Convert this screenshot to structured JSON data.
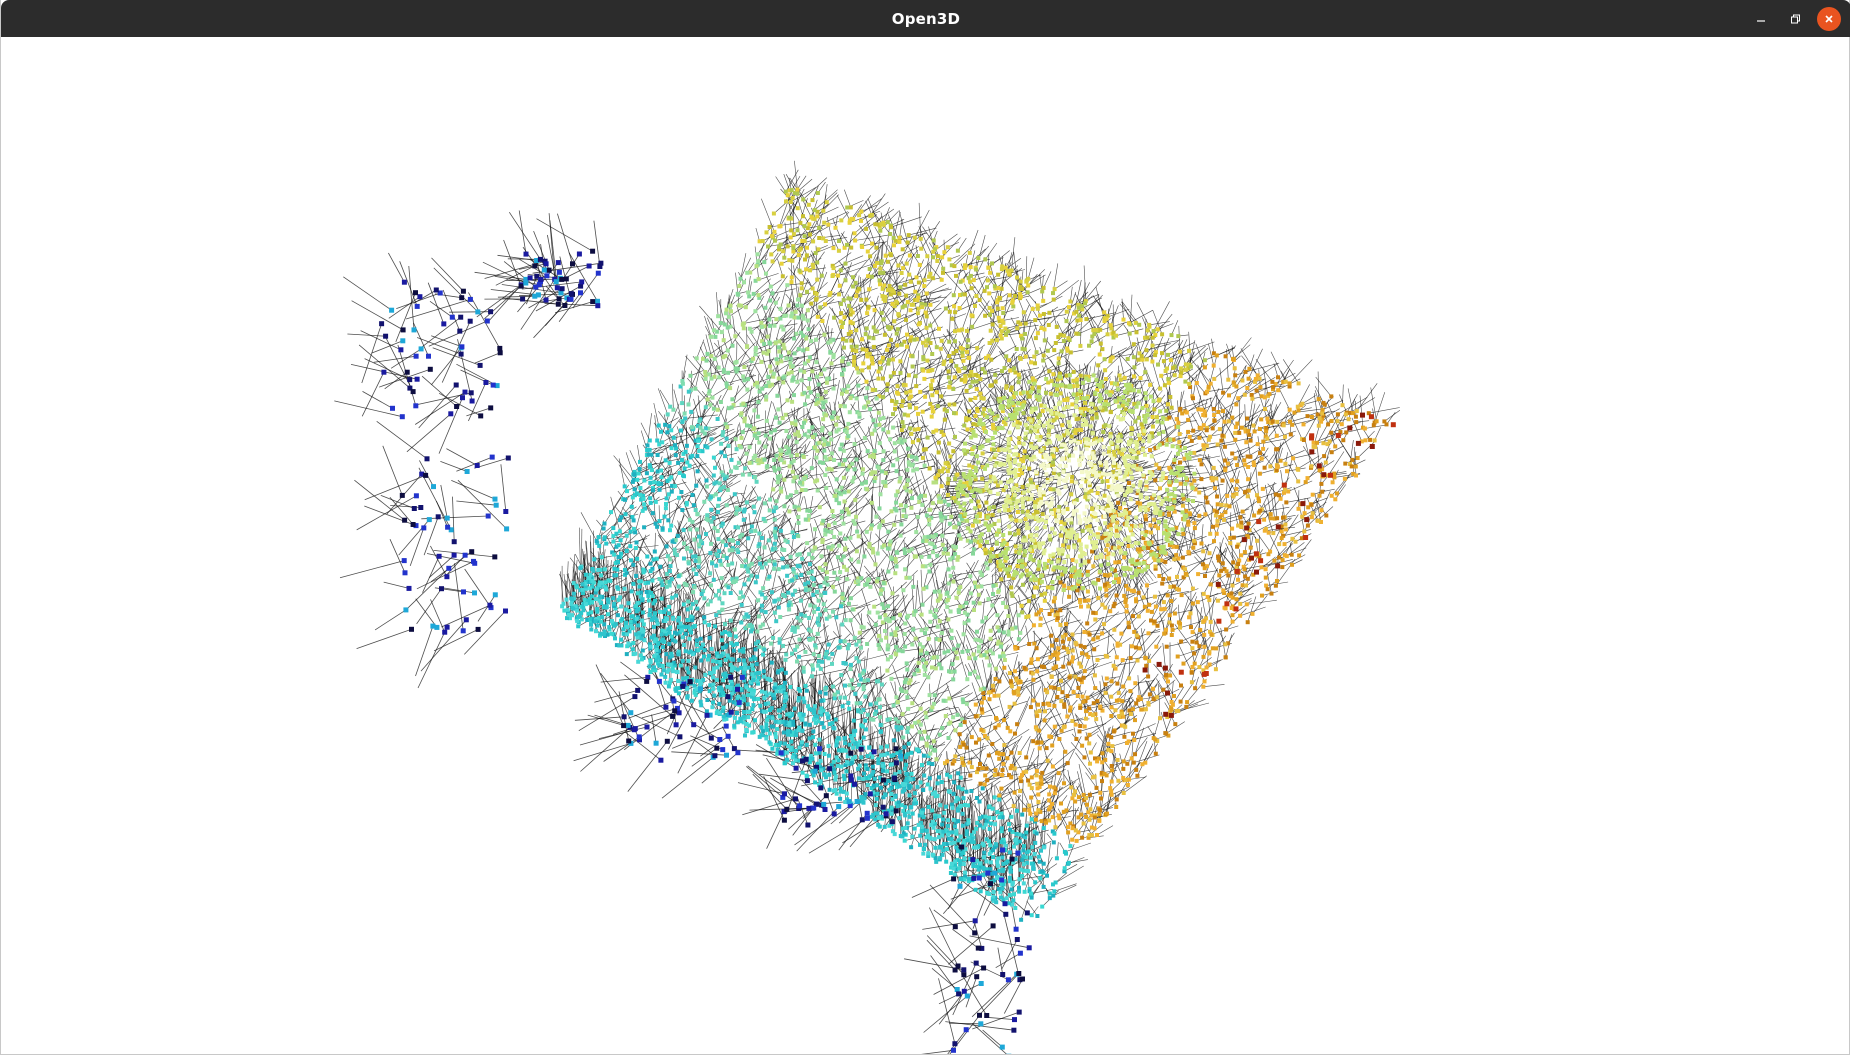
{
  "window": {
    "title": "Open3D",
    "controls": {
      "minimize_icon": "minimize-icon",
      "maximize_icon": "restore-icon",
      "close_icon": "close-icon"
    },
    "close_color": "#e95420",
    "titlebar_color": "#2c2c2c"
  },
  "scene": {
    "description_icon": "point-cloud-with-normals",
    "background": "#ffffff",
    "normal_line_color": "#000000",
    "palette": [
      "#1a1aa0",
      "#2233cc",
      "#22b8c8",
      "#3fd6d0",
      "#9fe2a0",
      "#cfe87a",
      "#e8d23a",
      "#e0a020",
      "#c87a10",
      "#b03010"
    ]
  }
}
